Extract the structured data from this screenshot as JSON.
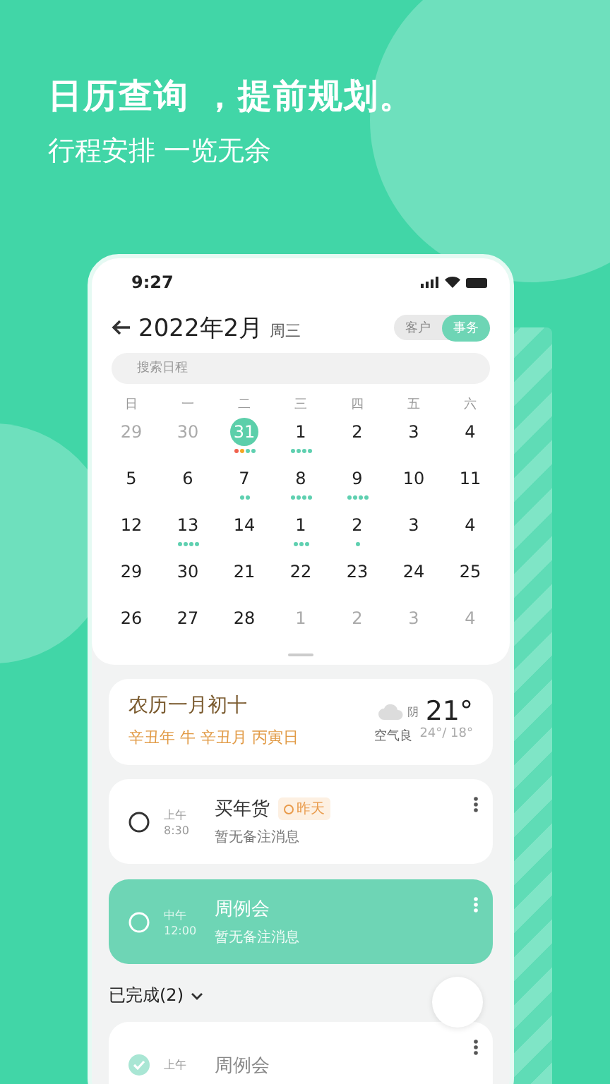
{
  "headline": "日历查询 ，提前规划。",
  "subheadline": "行程安排 一览无余",
  "status_bar": {
    "time": "9:27"
  },
  "header": {
    "title": "2022年2月",
    "weekday": "周三",
    "segments": [
      {
        "label": "客户",
        "selected": false
      },
      {
        "label": "事务",
        "selected": true
      }
    ]
  },
  "search": {
    "placeholder": "搜索日程"
  },
  "calendar": {
    "weekdays": [
      "日",
      "一",
      "二",
      "三",
      "四",
      "五",
      "六"
    ],
    "weeks": [
      [
        {
          "day": "29",
          "muted": true,
          "selected": false
        },
        {
          "day": "30",
          "muted": true,
          "selected": false
        },
        {
          "day": "31",
          "muted": false,
          "selected": true,
          "markers": [
            {
              "color": "#f0604d"
            },
            {
              "color": "#f5a623"
            },
            {
              "color": "#5fd0b0"
            },
            {
              "color": "#5fd0b0"
            }
          ]
        },
        {
          "day": "1",
          "muted": false,
          "selected": false,
          "markers": [
            {
              "color": "#5fd0b0"
            },
            {
              "color": "#5fd0b0"
            },
            {
              "color": "#5fd0b0"
            },
            {
              "color": "#5fd0b0"
            }
          ]
        },
        {
          "day": "2",
          "muted": false,
          "selected": false
        },
        {
          "day": "3",
          "muted": false,
          "selected": false
        },
        {
          "day": "4",
          "muted": false,
          "selected": false
        }
      ],
      [
        {
          "day": "5",
          "muted": false,
          "selected": false
        },
        {
          "day": "6",
          "muted": false,
          "selected": false
        },
        {
          "day": "7",
          "muted": false,
          "selected": false,
          "markers": [
            {
              "color": "#5fd0b0"
            },
            {
              "color": "#5fd0b0"
            }
          ]
        },
        {
          "day": "8",
          "muted": false,
          "selected": false,
          "markers": [
            {
              "color": "#5fd0b0"
            },
            {
              "color": "#5fd0b0"
            },
            {
              "color": "#5fd0b0"
            },
            {
              "color": "#5fd0b0"
            }
          ]
        },
        {
          "day": "9",
          "muted": false,
          "selected": false,
          "markers": [
            {
              "color": "#5fd0b0"
            },
            {
              "color": "#5fd0b0"
            },
            {
              "color": "#5fd0b0"
            },
            {
              "color": "#5fd0b0"
            }
          ]
        },
        {
          "day": "10",
          "muted": false,
          "selected": false
        },
        {
          "day": "11",
          "muted": false,
          "selected": false
        }
      ],
      [
        {
          "day": "12",
          "muted": false,
          "selected": false
        },
        {
          "day": "13",
          "muted": false,
          "selected": false,
          "markers": [
            {
              "color": "#5fd0b0"
            },
            {
              "color": "#5fd0b0"
            },
            {
              "color": "#5fd0b0"
            },
            {
              "color": "#5fd0b0"
            }
          ]
        },
        {
          "day": "14",
          "muted": false,
          "selected": false
        },
        {
          "day": "1",
          "muted": false,
          "selected": false,
          "markers": [
            {
              "color": "#5fd0b0"
            },
            {
              "color": "#5fd0b0"
            },
            {
              "color": "#5fd0b0"
            }
          ]
        },
        {
          "day": "2",
          "muted": false,
          "selected": false,
          "markers": [
            {
              "color": "#5fd0b0"
            }
          ]
        },
        {
          "day": "3",
          "muted": false,
          "selected": false
        },
        {
          "day": "4",
          "muted": false,
          "selected": false
        }
      ],
      [
        {
          "day": "29",
          "muted": false,
          "selected": false
        },
        {
          "day": "30",
          "muted": false,
          "selected": false
        },
        {
          "day": "21",
          "muted": false,
          "selected": false
        },
        {
          "day": "22",
          "muted": false,
          "selected": false
        },
        {
          "day": "23",
          "muted": false,
          "selected": false
        },
        {
          "day": "24",
          "muted": false,
          "selected": false
        },
        {
          "day": "25",
          "muted": false,
          "selected": false
        }
      ],
      [
        {
          "day": "26",
          "muted": false,
          "selected": false
        },
        {
          "day": "27",
          "muted": false,
          "selected": false
        },
        {
          "day": "28",
          "muted": false,
          "selected": false
        },
        {
          "day": "1",
          "muted": true,
          "selected": false
        },
        {
          "day": "2",
          "muted": true,
          "selected": false
        },
        {
          "day": "3",
          "muted": true,
          "selected": false
        },
        {
          "day": "4",
          "muted": true,
          "selected": false
        }
      ]
    ]
  },
  "lunar": {
    "date": "农历一月初十",
    "ganzhi": "辛丑年 牛 辛丑月 丙寅日",
    "condition": "阴",
    "air": "空气良",
    "temperature": "21°",
    "range": "24°/ 18°"
  },
  "tasks": [
    {
      "period": "上午",
      "time": "8:30",
      "title": "买年货",
      "tag": "昨天",
      "note": "暂无备注消息",
      "checked": false,
      "highlighted": false
    },
    {
      "period": "中午",
      "time": "12:00",
      "title": "周例会",
      "note": "暂无备注消息",
      "checked": false,
      "highlighted": true
    }
  ],
  "completed": {
    "label": "已完成(2)",
    "items": [
      {
        "period": "上午",
        "title": "周例会",
        "checked": true
      }
    ]
  }
}
